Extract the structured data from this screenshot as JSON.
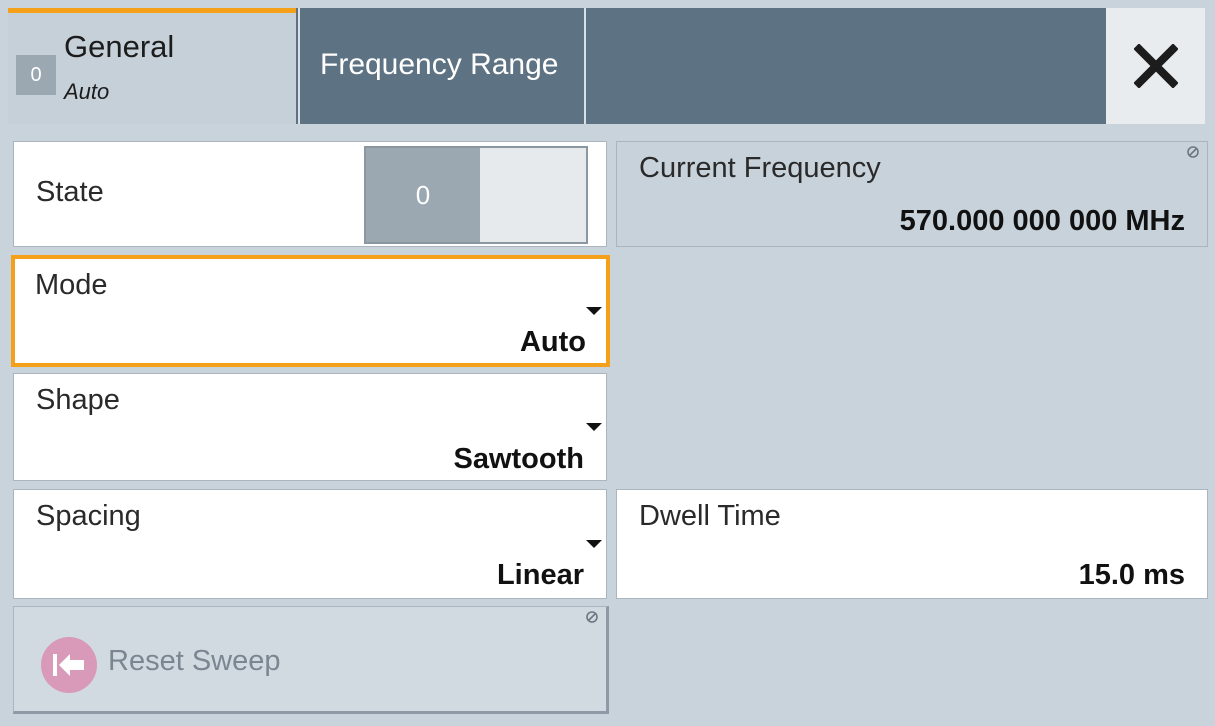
{
  "tabs": {
    "general": {
      "state": "0",
      "title": "General",
      "subtitle": "Auto"
    },
    "frequency_range": {
      "title": "Frequency Range"
    }
  },
  "state": {
    "label": "State",
    "toggle_value": "0"
  },
  "current_frequency": {
    "label": "Current Frequency",
    "value": "570.000 000 000 MHz"
  },
  "mode": {
    "label": "Mode",
    "value": "Auto"
  },
  "shape": {
    "label": "Shape",
    "value": "Sawtooth"
  },
  "spacing": {
    "label": "Spacing",
    "value": "Linear"
  },
  "dwell_time": {
    "label": "Dwell Time",
    "value": "15.0 ms"
  },
  "reset_sweep": {
    "label": "Reset Sweep"
  },
  "colors": {
    "accent": "#f5a01a",
    "tab_bar": "#5d7282",
    "background": "#c9d3dc",
    "reset_icon": "#d89ab8"
  },
  "icons": {
    "close": "close-icon",
    "read_only": "read-only-icon",
    "reset": "reset-arrow-icon",
    "dropdown": "dropdown-arrow-icon"
  }
}
